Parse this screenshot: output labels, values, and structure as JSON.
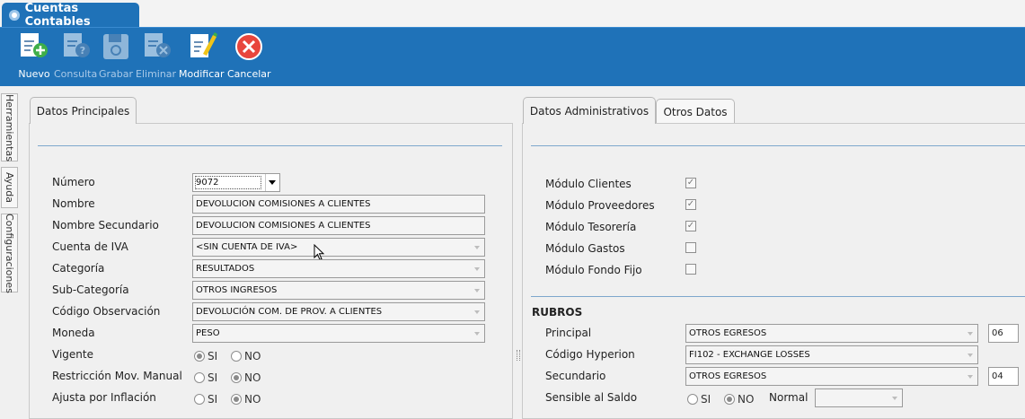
{
  "window": {
    "tab_title": "Cuentas Contables"
  },
  "toolbar": {
    "buttons": [
      {
        "label": "Nuevo",
        "icon": "new-document-icon"
      },
      {
        "label": "Consulta",
        "icon": "query-document-icon"
      },
      {
        "label": "Grabar",
        "icon": "save-disk-icon"
      },
      {
        "label": "Eliminar",
        "icon": "delete-document-icon"
      },
      {
        "label": "Modificar",
        "icon": "edit-document-icon"
      },
      {
        "label": "Cancelar",
        "icon": "cancel-icon"
      }
    ]
  },
  "sidebar": {
    "tabs": [
      {
        "label": "Herramientas"
      },
      {
        "label": "Ayuda"
      },
      {
        "label": "Configuraciones"
      }
    ]
  },
  "left": {
    "tab": "Datos Principales",
    "labels": {
      "numero": "Número",
      "nombre": "Nombre",
      "nombre_secundario": "Nombre Secundario",
      "cuenta_iva": "Cuenta de IVA",
      "categoria": "Categoría",
      "subcategoria": "Sub-Categoría",
      "codigo_obs": "Código Observación",
      "moneda": "Moneda",
      "vigente": "Vigente",
      "restriccion": "Restricción Mov. Manual",
      "ajusta": "Ajusta por Inflación"
    },
    "values": {
      "numero": "9072",
      "nombre": "DEVOLUCION COMISIONES A CLIENTES",
      "nombre_secundario": "DEVOLUCION COMISIONES A CLIENTES",
      "cuenta_iva": "<SIN CUENTA DE IVA>",
      "categoria": "RESULTADOS",
      "subcategoria": "OTROS INGRESOS",
      "codigo_obs": "DEVOLUCIÓN COM. DE PROV. A CLIENTES",
      "moneda": "PESO"
    },
    "radio": {
      "si": "SI",
      "no": "NO"
    }
  },
  "right": {
    "tabs": [
      "Datos Administrativos",
      "Otros Datos"
    ],
    "modules": [
      {
        "label": "Módulo Clientes",
        "checked": true
      },
      {
        "label": "Módulo Proveedores",
        "checked": true
      },
      {
        "label": "Módulo Tesorería",
        "checked": true
      },
      {
        "label": "Módulo Gastos",
        "checked": false
      },
      {
        "label": "Módulo Fondo Fijo",
        "checked": false
      }
    ],
    "rubros": {
      "title": "RUBROS",
      "labels": {
        "principal": "Principal",
        "codigo_hyperion": "Código Hyperion",
        "secundario": "Secundario",
        "sensible": "Sensible al Saldo",
        "normal": "Normal"
      },
      "values": {
        "principal": "OTROS EGRESOS",
        "principal_code": "06",
        "codigo_hyperion": "FI102 - EXCHANGE LOSSES",
        "secundario": "OTROS EGRESOS",
        "secundario_code": "04",
        "normal": ""
      },
      "radio": {
        "si": "SI",
        "no": "NO"
      }
    }
  }
}
